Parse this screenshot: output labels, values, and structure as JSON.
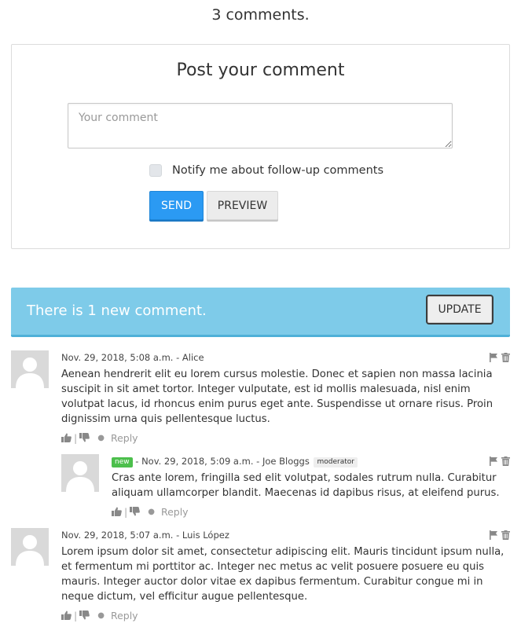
{
  "header": {
    "count_text": "3 comments."
  },
  "post_form": {
    "title": "Post your comment",
    "comment_placeholder": "Your comment",
    "notify_label": "Notify me about follow-up comments",
    "notify_checked": false,
    "send_label": "SEND",
    "preview_label": "PREVIEW"
  },
  "banner": {
    "text": "There is 1 new comment.",
    "update_label": "UPDATE"
  },
  "comments": [
    {
      "meta": "Nov. 29, 2018, 5:08 a.m. - Alice",
      "text": "Aenean hendrerit elit eu lorem cursus molestie. Donec et sapien non massa lacinia suscipit in sit amet tortor. Integer vulputate, est id mollis malesuada, nisl enim volutpat lacus, id rhoncus enim purus eget ante. Suspendisse ut ornare risus. Proin dignissim urna quis pellentesque luctus.",
      "reply_label": "Reply"
    },
    {
      "badge": "new",
      "meta": "- Nov. 29, 2018, 5:09 a.m. - Joe Bloggs",
      "role": "moderator",
      "text": "Cras ante lorem, fringilla sed elit volutpat, sodales rutrum nulla. Curabitur aliquam ullamcorper blandit. Maecenas id dapibus risus, at eleifend purus.",
      "reply_label": "Reply"
    },
    {
      "meta": "Nov. 29, 2018, 5:07 a.m. - Luis López",
      "text": "Lorem ipsum dolor sit amet, consectetur adipiscing elit. Mauris tincidunt ipsum nulla, et fermentum mi porttitor ac. Integer nec metus ac velit posuere posuere eu quis mauris. Integer auctor dolor vitae ex dapibus fermentum. Curabitur congue mi in neque dictum, vel efficitur augue pellentesque.",
      "reply_label": "Reply"
    }
  ],
  "colors": {
    "send_button": "#2b9af3",
    "banner": "#7ecbe9",
    "new_badge": "#4cbf4c",
    "icon": "#888888"
  },
  "icons": [
    "thumbs-up-icon",
    "thumbs-down-icon",
    "flag-icon",
    "trash-icon"
  ]
}
